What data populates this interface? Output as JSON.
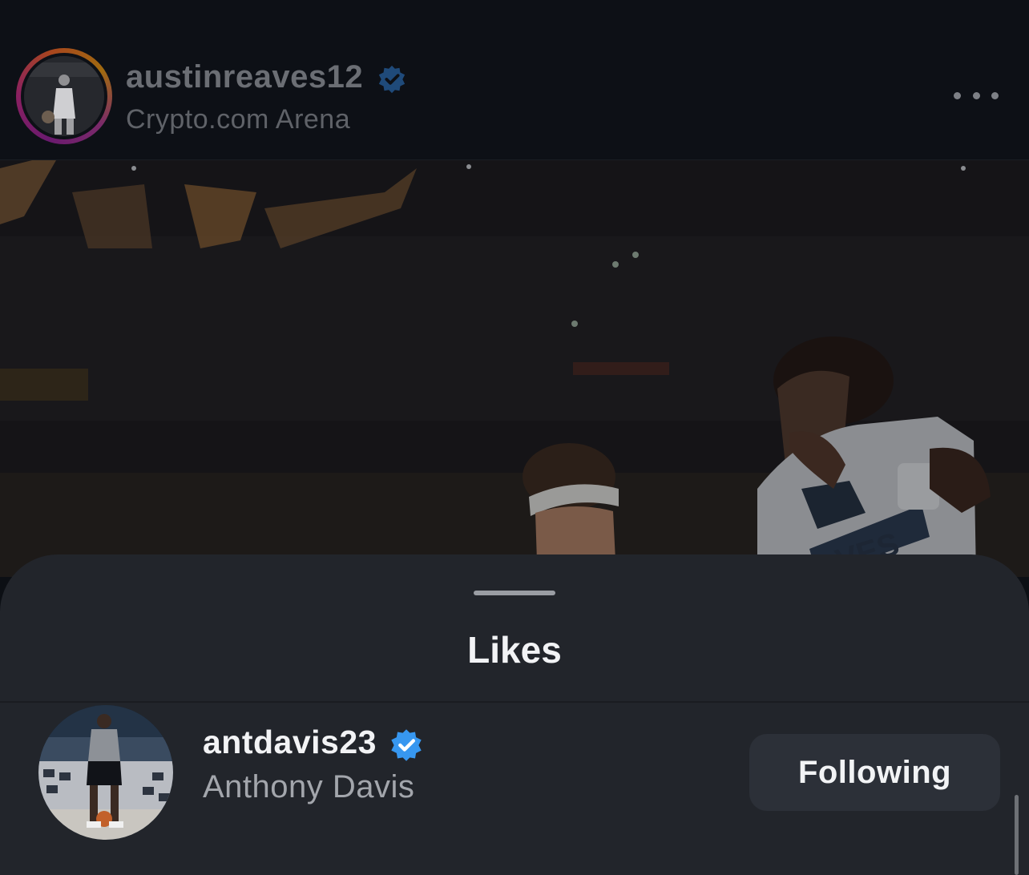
{
  "post": {
    "username": "austinreaves12",
    "location": "Crypto.com Arena",
    "jersey_text": "VES"
  },
  "likes_sheet": {
    "title": "Likes",
    "users": [
      {
        "username": "antdavis23",
        "full_name": "Anthony Davis",
        "follow_label": "Following",
        "verified": true
      }
    ]
  },
  "icons": {
    "verified": "verified-badge-icon",
    "more": "more-options-icon"
  },
  "colors": {
    "verified_blue": "#3797f0",
    "sheet_bg": "#22252b",
    "button_bg": "#2c3038"
  }
}
